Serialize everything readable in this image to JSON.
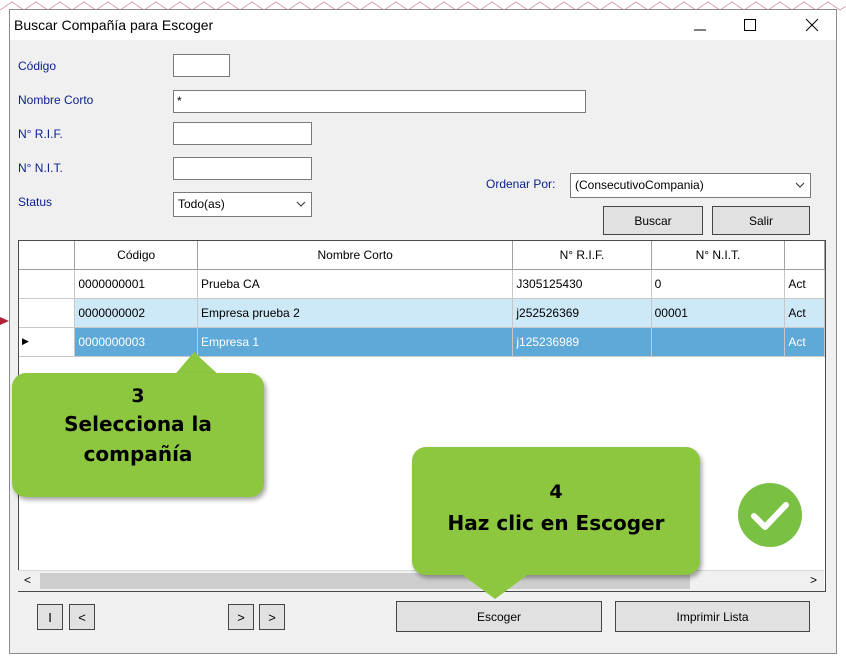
{
  "window": {
    "title": "Buscar Compañía para Escoger",
    "minimize_glyph": "—",
    "close_glyph": "✕"
  },
  "form": {
    "codigo_label": "Código",
    "codigo_value": "",
    "nombre_corto_label": "Nombre Corto",
    "nombre_corto_value": "*",
    "rif_label": "N° R.I.F.",
    "rif_value": "",
    "nit_label": "N° N.I.T.",
    "nit_value": "",
    "status_label": "Status",
    "status_value": "Todo(as)",
    "ordenar_label": "Ordenar Por:",
    "ordenar_value": "(ConsecutivoCompania)",
    "buscar_label": "Buscar",
    "salir_label": "Salir"
  },
  "grid": {
    "columns": [
      "Código",
      "Nombre Corto",
      "N° R.I.F.",
      "N° N.I.T.",
      ""
    ],
    "rows": [
      {
        "codigo": "0000000001",
        "nombre": "Prueba CA",
        "rif": "J305125430",
        "nit": "0",
        "status": "Act"
      },
      {
        "codigo": "0000000002",
        "nombre": "Empresa prueba 2",
        "rif": "j252526369",
        "nit": "00001",
        "status": "Act"
      },
      {
        "codigo": "0000000003",
        "nombre": "Empresa 1",
        "rif": "j125236989",
        "nit": "",
        "status": "Act"
      }
    ],
    "selected_row_index": 2,
    "row_indicator": "▶"
  },
  "nav": {
    "first": "I",
    "prev": "<",
    "next": ">",
    "last": ">"
  },
  "buttons": {
    "escoger": "Escoger",
    "imprimir": "Imprimir Lista"
  },
  "scroll": {
    "left_arrow": "<",
    "right_arrow": ">"
  },
  "callouts": {
    "step3_number": "3",
    "step3_text": "Selecciona la compañía",
    "step4_number": "4",
    "step4_text": "Haz clic en Escoger"
  },
  "colors": {
    "callout_green": "#8dc63f",
    "selected_row": "#5ea9d8",
    "alt_row": "#cde8f6",
    "check_green": "#7ac143",
    "label_blue": "#0a1e8c"
  },
  "icons": {
    "check": "check-circle-icon",
    "maximize": "maximize-icon",
    "dropdown": "chevron-down-icon"
  }
}
